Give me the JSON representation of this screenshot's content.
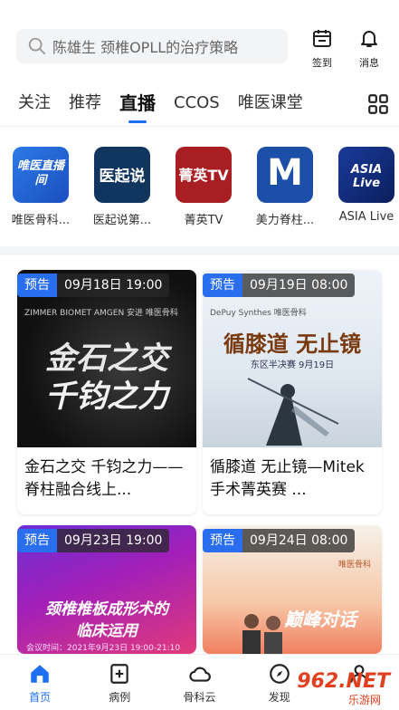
{
  "search": {
    "placeholder": "陈雄生 颈椎OPLL的治疗策略"
  },
  "top_actions": [
    {
      "label": "签到",
      "icon": "calendar-checkin-icon"
    },
    {
      "label": "消息",
      "icon": "bell-icon"
    }
  ],
  "tabs": [
    {
      "label": "关注",
      "active": false
    },
    {
      "label": "推荐",
      "active": false
    },
    {
      "label": "直播",
      "active": true
    },
    {
      "label": "CCOS",
      "active": false
    },
    {
      "label": "唯医课堂",
      "active": false
    }
  ],
  "channels": [
    {
      "name": "唯医骨科...",
      "logo_text": "唯医直播间"
    },
    {
      "name": "医起说第...",
      "logo_text": "医起说"
    },
    {
      "name": "菁英TV",
      "logo_text": "菁英TV"
    },
    {
      "name": "美力脊柱...",
      "logo_text": "M"
    },
    {
      "name": "ASIA Live",
      "logo_text": "ASIA Live"
    }
  ],
  "cards": [
    {
      "badge": "预告",
      "time": "09月18日 19:00",
      "title": "金石之交 千钧之力——脊柱融合线上...",
      "art_text_1": "金石之交",
      "art_text_2": "千钧之力",
      "sponsors": "ZIMMER BIOMET   AMGEN 安进   唯医骨科"
    },
    {
      "badge": "预告",
      "time": "09月19日 08:00",
      "title": "循膝道 无止镜—Mitek手术菁英赛 ...",
      "art_text_1": "循膝道 无止镜",
      "art_text_2": "东区半决赛  9月19日",
      "sponsors": "DePuy Synthes   唯医骨科"
    },
    {
      "badge": "预告",
      "time": "09月23日 19:00",
      "title": "",
      "art_text_1": "颈椎椎板成形术的",
      "art_text_2": "临床运用",
      "art_text_3": "会议时间：2021年9月23日  19:00-21:10"
    },
    {
      "badge": "预告",
      "time": "09月24日 08:00",
      "title": "",
      "art_text_1": "巅峰对话",
      "sponsors": "唯医骨科"
    }
  ],
  "bottom_nav": [
    {
      "label": "首页",
      "icon": "home-icon",
      "active": true
    },
    {
      "label": "病例",
      "icon": "case-add-icon",
      "active": false
    },
    {
      "label": "骨科云",
      "icon": "cloud-icon",
      "active": false
    },
    {
      "label": "发现",
      "icon": "discover-icon",
      "active": false
    },
    {
      "label": "",
      "icon": "profile-icon",
      "active": false
    }
  ],
  "watermark": {
    "text": "962.NET",
    "sub": "乐游网"
  },
  "colors": {
    "accent": "#1f6ff2",
    "badge": "#2a6ef0"
  }
}
